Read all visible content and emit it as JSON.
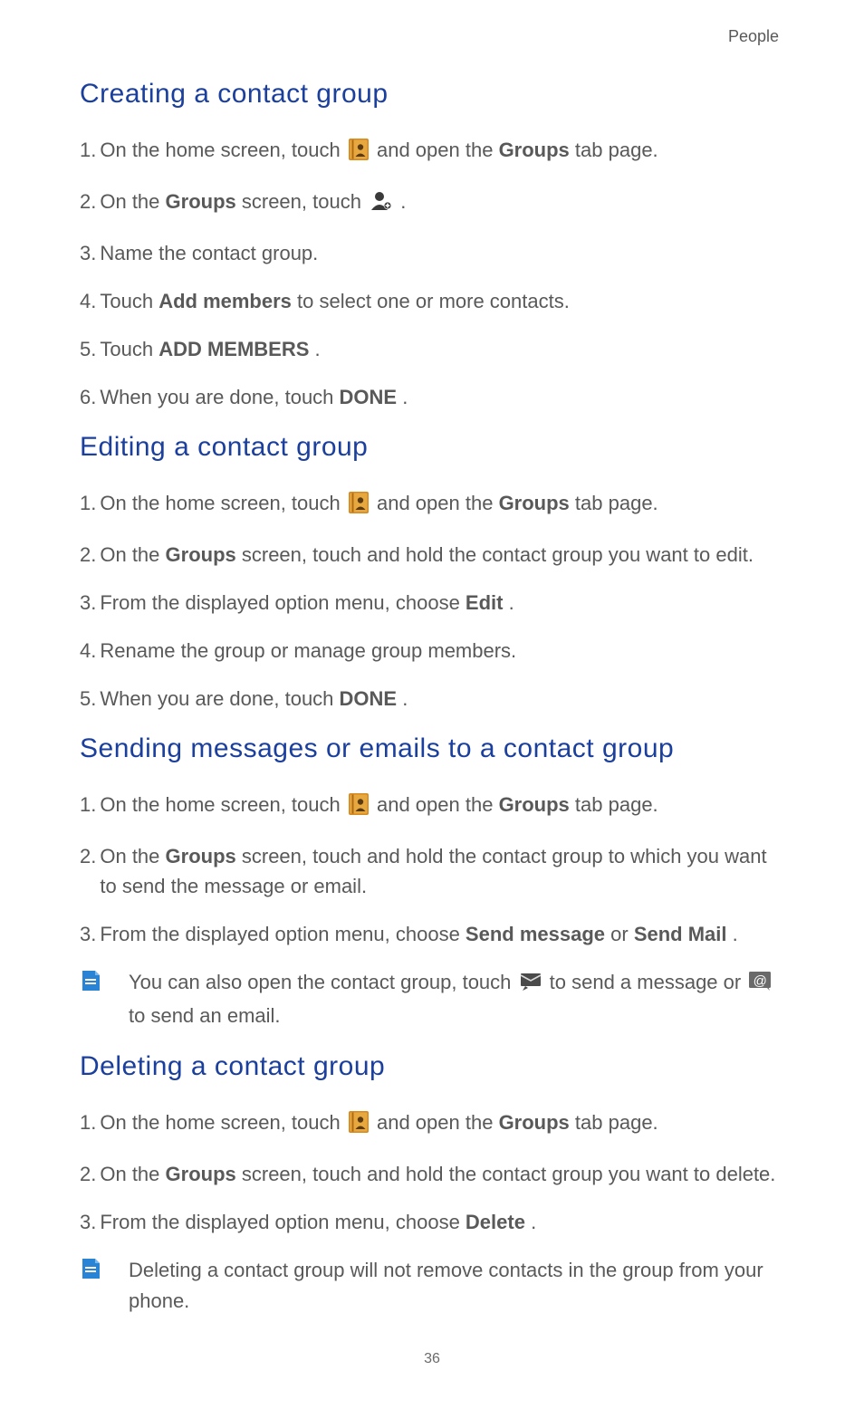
{
  "header": {
    "chapter": "People"
  },
  "common": {
    "home_touch_pre": " On the home screen, touch ",
    "home_touch_post": " and open the ",
    "groups_label": "Groups",
    "tab_page_suffix": " tab page.",
    "on_the": " On the ",
    "screen_touch": " screen, touch ",
    "screen_touch_hold": " screen, touch and hold the contact group ",
    "from_menu": " From the displayed option menu, choose ",
    "when_done_pre": " When you are done, touch ",
    "done_label": "DONE",
    "period": "."
  },
  "sections": {
    "creating": {
      "title": "Creating a contact group",
      "s2_suffix": " .",
      "s3": " Name the contact group.",
      "s4_pre": " Touch ",
      "s4_bold": "Add members",
      "s4_post": " to select one or more contacts.",
      "s5_pre": " Touch ",
      "s5_bold": "ADD MEMBERS",
      "s5_post": "."
    },
    "editing": {
      "title": "Editing a contact group",
      "s2_suffix": "you want to edit.",
      "s3_bold": "Edit",
      "s4": " Rename the group or manage group members."
    },
    "sending": {
      "title": "Sending messages or emails to a contact group",
      "s2_suffix": "to which you want to send the message or email.",
      "s3_bold1": "Send message",
      "s3_or": " or ",
      "s3_bold2": "Send Mail",
      "note1a": "You can also open the contact group, touch ",
      "note1b": " to send a message or ",
      "note1c": " to send an email."
    },
    "deleting": {
      "title": "Deleting a contact group",
      "s2_suffix": "you want to delete.",
      "s3_bold": "Delete",
      "note": "Deleting a contact group will not remove contacts in the group from your phone."
    }
  },
  "footer": {
    "page": "36"
  }
}
